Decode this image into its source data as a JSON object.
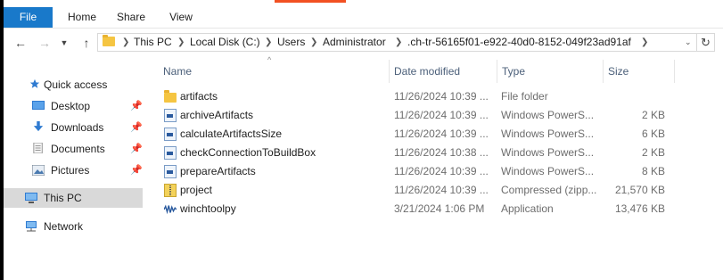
{
  "ribbon": {
    "tabs": [
      "File",
      "Home",
      "Share",
      "View"
    ]
  },
  "address": {
    "crumbs": [
      "This PC",
      "Local Disk (C:)",
      "Users",
      "Administrator",
      ".ch-tr-56165f01-e922-40d0-8152-049f23ad91af"
    ]
  },
  "nav_pane": {
    "quick_access": "Quick access",
    "items": [
      {
        "label": "Desktop",
        "icon": "desktop-icon",
        "pinned": true
      },
      {
        "label": "Downloads",
        "icon": "download-icon",
        "pinned": true
      },
      {
        "label": "Documents",
        "icon": "documents-icon",
        "pinned": true
      },
      {
        "label": "Pictures",
        "icon": "pictures-icon",
        "pinned": true
      }
    ],
    "this_pc": "This PC",
    "network": "Network"
  },
  "columns": {
    "name": "Name",
    "date_modified": "Date modified",
    "type": "Type",
    "size": "Size"
  },
  "files": [
    {
      "name": "artifacts",
      "date": "11/26/2024 10:39 ...",
      "type": "File folder",
      "size": "",
      "icon": "folder-icon"
    },
    {
      "name": "archiveArtifacts",
      "date": "11/26/2024 10:39 ...",
      "type": "Windows PowerS...",
      "size": "2 KB",
      "icon": "powershell-script-icon"
    },
    {
      "name": "calculateArtifactsSize",
      "date": "11/26/2024 10:39 ...",
      "type": "Windows PowerS...",
      "size": "6 KB",
      "icon": "powershell-script-icon"
    },
    {
      "name": "checkConnectionToBuildBox",
      "date": "11/26/2024 10:38 ...",
      "type": "Windows PowerS...",
      "size": "2 KB",
      "icon": "powershell-script-icon"
    },
    {
      "name": "prepareArtifacts",
      "date": "11/26/2024 10:39 ...",
      "type": "Windows PowerS...",
      "size": "8 KB",
      "icon": "powershell-script-icon"
    },
    {
      "name": "project",
      "date": "11/26/2024 10:39 ...",
      "type": "Compressed (zipp...",
      "size": "21,570 KB",
      "icon": "zip-folder-icon"
    },
    {
      "name": "winchtoolpy",
      "date": "3/21/2024 1:06 PM",
      "type": "Application",
      "size": "13,476 KB",
      "icon": "application-icon"
    }
  ],
  "colors": {
    "file_tab": "#1979ca",
    "selected_nav": "#d9d9d9",
    "header_text": "#4c607a",
    "folder": "#f5c542"
  }
}
